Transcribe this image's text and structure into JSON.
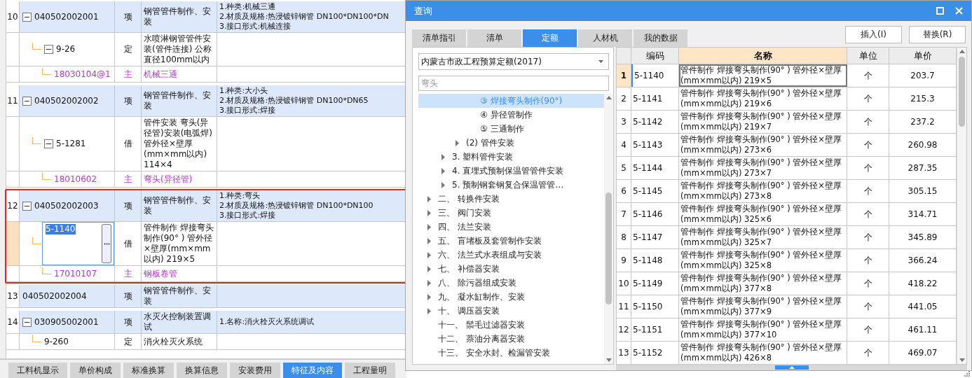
{
  "bill_table": {
    "rows": [
      {
        "kind": "item",
        "no": "10",
        "code": "040502002001",
        "type": "项",
        "name": "钢管管件制作、安装",
        "features": [
          "1.种类:机械三通",
          "2.材质及规格:热浸镀锌钢管 DN100*DN100*DN",
          "3.接口形式:机械连接"
        ],
        "expanded": true,
        "highlighted": false,
        "children": [
          {
            "kind": "quota",
            "code": "9-26",
            "type": "定",
            "name": "水喷淋钢管管件安装(管件连接) 公称直径100mm以内",
            "expanded": true,
            "children": [
              {
                "kind": "material",
                "code": "18030104@1",
                "type": "主",
                "name": "机械三通"
              }
            ]
          }
        ]
      },
      {
        "kind": "item",
        "no": "11",
        "code": "040502002002",
        "type": "项",
        "name": "钢管管件制作、安装",
        "features": [
          "1.种类:大小头",
          "2.材质及规格:热浸镀锌钢管 DN100*DN65",
          "3.接口形式:焊接"
        ],
        "expanded": true,
        "highlighted": false,
        "children": [
          {
            "kind": "quota",
            "code": "5-1281",
            "type": "借",
            "name": "管件安装 弯头(异径管)安装(电弧焊) 管外径×壁厚(mm×mm以内) 114×4",
            "expanded": true,
            "children": [
              {
                "kind": "material",
                "code": "18010602",
                "type": "主",
                "name": "弯头(异径管)"
              }
            ]
          }
        ]
      },
      {
        "kind": "item",
        "no": "12",
        "code": "040502002003",
        "type": "项",
        "name": "钢管管件制作、安装",
        "features": [
          "1.种类:弯头",
          "2.材质及规格:热浸镀锌钢管 DN100*DN100",
          "3.接口形式:焊接"
        ],
        "expanded": true,
        "highlighted": true,
        "children": [
          {
            "kind": "quota",
            "code": "5-1140",
            "type": "借",
            "name": "管件制作 焊接弯头制作(90° ) 管外径×壁厚(mm×mm以内) 219×5",
            "editing": true,
            "children": [
              {
                "kind": "material",
                "code": "17010107",
                "type": "主",
                "name": "钢板卷管"
              }
            ]
          }
        ]
      },
      {
        "kind": "item",
        "no": "13",
        "code": "040502002004",
        "type": "项",
        "name": "钢管管件制作、安装",
        "features": [],
        "highlighted": false
      },
      {
        "kind": "item",
        "no": "14",
        "code": "030905002001",
        "type": "项",
        "name": "水灭火控制装置调试",
        "features": [
          "1.名称:消火栓灭火系统调试"
        ],
        "expanded": true,
        "highlighted": false,
        "children": [
          {
            "kind": "quota",
            "code": "9-260",
            "type": "定",
            "name": "消火栓灭火系统"
          }
        ]
      }
    ]
  },
  "bottom_tabs": [
    {
      "label": "工料机显示",
      "selected": false
    },
    {
      "label": "单价构成",
      "selected": false
    },
    {
      "label": "标准换算",
      "selected": false
    },
    {
      "label": "换算信息",
      "selected": false
    },
    {
      "label": "安装费用",
      "selected": false
    },
    {
      "label": "特征及内容",
      "selected": true
    },
    {
      "label": "工程量明",
      "selected": false
    }
  ],
  "dialog": {
    "title": "查询",
    "tabs": [
      {
        "label": "清单指引",
        "selected": false
      },
      {
        "label": "清单",
        "selected": false
      },
      {
        "label": "定额",
        "selected": true
      },
      {
        "label": "人材机",
        "selected": false
      },
      {
        "label": "我的数据",
        "selected": false
      }
    ],
    "buttons": [
      "插入(I)",
      "替换(R)"
    ],
    "quota_book": "内蒙古市政工程预算定额(2017)",
    "search": {
      "value": "弯头"
    },
    "tree": [
      {
        "children": [
          {
            "children": [
              {
                "children": [
                  {
                    "label": "③ 焊接弯头制作(90°)",
                    "selected": true
                  },
                  {
                    "label": "④ 异径管制作",
                    "selected": false
                  },
                  {
                    "label": "⑤ 三通制作",
                    "selected": false
                  }
                ]
              },
              {
                "label": "(2) 管件安装",
                "selected": false,
                "expanded": false
              }
            ]
          },
          {
            "label": "3. 塑料管件安装",
            "selected": false,
            "expanded": false
          },
          {
            "label": "4. 直埋式预制保温管管件安装",
            "selected": false,
            "expanded": false
          },
          {
            "label": "5. 预制钢套钢复合保温管管…",
            "selected": false,
            "expanded": false
          }
        ]
      },
      {
        "label": "二、 转换件安装",
        "selected": false,
        "expanded": false
      },
      {
        "label": "三、 阀门安装",
        "selected": false,
        "expanded": false
      },
      {
        "label": "四、 法兰安装",
        "selected": false,
        "expanded": false
      },
      {
        "label": "五、 盲堵板及套管制作安装",
        "selected": false,
        "expanded": false
      },
      {
        "label": "六、 法兰式水表组成与安装",
        "selected": false,
        "expanded": false
      },
      {
        "label": "七、 补偿器安装",
        "selected": false,
        "expanded": false
      },
      {
        "label": "八、 除污器组成安装",
        "selected": false,
        "expanded": false
      },
      {
        "label": "九、 凝水缸制作、安装",
        "selected": false,
        "expanded": false
      },
      {
        "label": "十、 调压器安装",
        "selected": false,
        "expanded": false
      },
      {
        "label": "十一、 鬃毛过滤器安装",
        "selected": false
      },
      {
        "label": "十二、 萘油分离器安装",
        "selected": false
      },
      {
        "label": "十三、 安全水封、检漏管安装",
        "selected": false
      }
    ],
    "table": {
      "columns": [
        {
          "label": "编码",
          "selected": false
        },
        {
          "label": "名称",
          "selected": true
        },
        {
          "label": "单位",
          "selected": false
        },
        {
          "label": "单价",
          "selected": false
        }
      ],
      "rows": [
        {
          "no": "1",
          "code": "5-1140",
          "name": "管件制作 焊接弯头制作(90° ) 管外径×壁厚(mm×mm以内) 219×5",
          "unit": "个",
          "price": "203.7",
          "selected": true
        },
        {
          "no": "2",
          "code": "5-1141",
          "name": "管件制作 焊接弯头制作(90° ) 管外径×壁厚(mm×mm以内) 219×6",
          "unit": "个",
          "price": "215.3",
          "selected": false
        },
        {
          "no": "3",
          "code": "5-1142",
          "name": "管件制作 焊接弯头制作(90° ) 管外径×壁厚(mm×mm以内) 219×7",
          "unit": "个",
          "price": "237.2",
          "selected": false
        },
        {
          "no": "4",
          "code": "5-1143",
          "name": "管件制作 焊接弯头制作(90° ) 管外径×壁厚(mm×mm以内) 273×6",
          "unit": "个",
          "price": "260.98",
          "selected": false
        },
        {
          "no": "5",
          "code": "5-1144",
          "name": "管件制作 焊接弯头制作(90° ) 管外径×壁厚(mm×mm以内) 273×7",
          "unit": "个",
          "price": "287.35",
          "selected": false
        },
        {
          "no": "6",
          "code": "5-1145",
          "name": "管件制作 焊接弯头制作(90° ) 管外径×壁厚(mm×mm以内) 273×8",
          "unit": "个",
          "price": "305.15",
          "selected": false
        },
        {
          "no": "7",
          "code": "5-1146",
          "name": "管件制作 焊接弯头制作(90° ) 管外径×壁厚(mm×mm以内) 325×6",
          "unit": "个",
          "price": "314.71",
          "selected": false
        },
        {
          "no": "8",
          "code": "5-1147",
          "name": "管件制作 焊接弯头制作(90° ) 管外径×壁厚(mm×mm以内) 325×7",
          "unit": "个",
          "price": "345.89",
          "selected": false
        },
        {
          "no": "9",
          "code": "5-1148",
          "name": "管件制作 焊接弯头制作(90° ) 管外径×壁厚(mm×mm以内) 325×8",
          "unit": "个",
          "price": "366.24",
          "selected": false
        },
        {
          "no": "10",
          "code": "5-1149",
          "name": "管件制作 焊接弯头制作(90° ) 管外径×壁厚(mm×mm以内) 377×8",
          "unit": "个",
          "price": "418.22",
          "selected": false
        },
        {
          "no": "11",
          "code": "5-1150",
          "name": "管件制作 焊接弯头制作(90° ) 管外径×壁厚(mm×mm以内) 377×9",
          "unit": "个",
          "price": "441.05",
          "selected": false
        },
        {
          "no": "12",
          "code": "5-1151",
          "name": "管件制作 焊接弯头制作(90° ) 管外径×壁厚(mm×mm以内) 377×10",
          "unit": "个",
          "price": "461.11",
          "selected": false
        },
        {
          "no": "13",
          "code": "5-1152",
          "name": "管件制作 焊接弯头制作(90° ) 管外径×壁厚(mm×mm以内) 426×8",
          "unit": "个",
          "price": "469.07",
          "selected": false
        }
      ]
    }
  }
}
